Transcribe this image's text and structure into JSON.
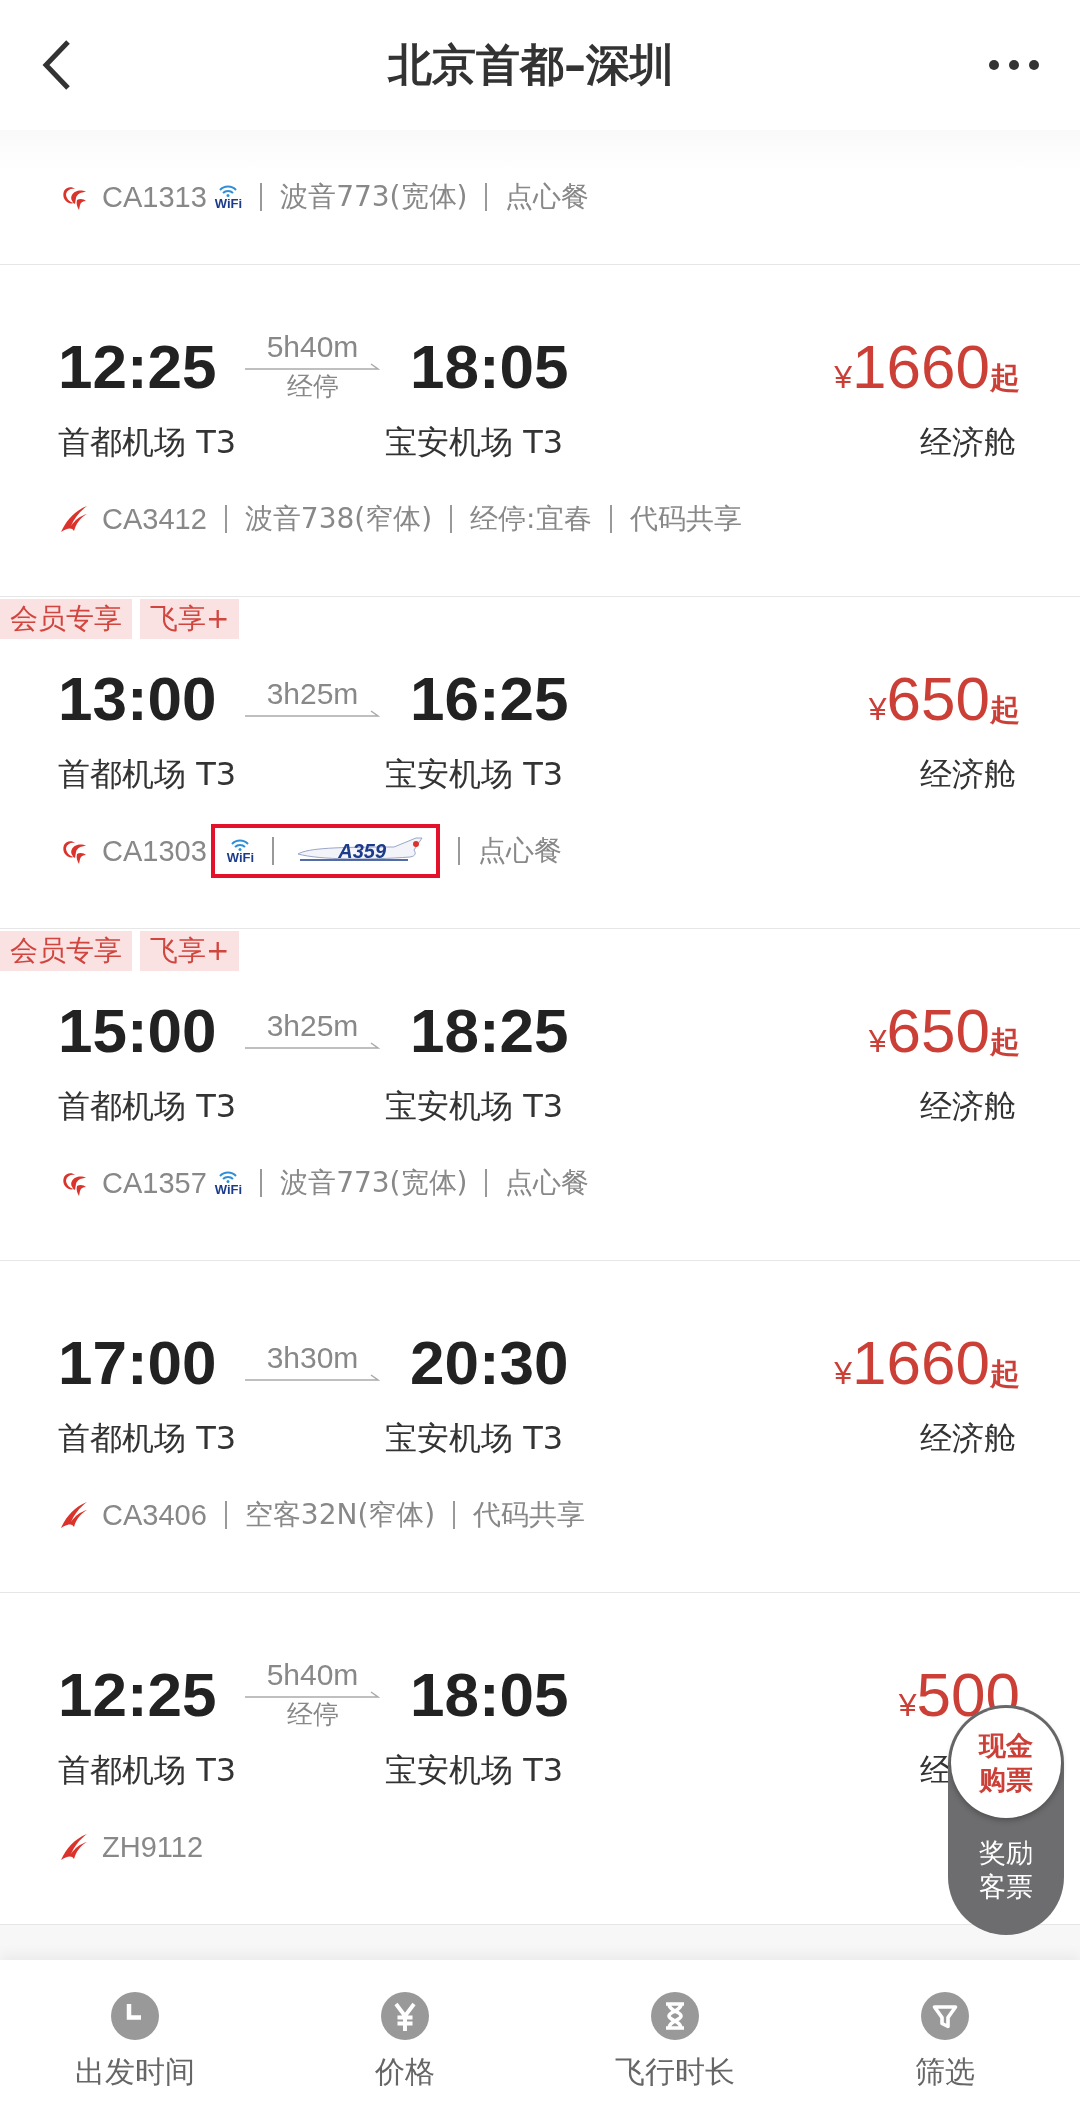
{
  "header": {
    "title": "北京首都–深圳"
  },
  "partial_flight": {
    "logo": {
      "kind": "phoenix"
    },
    "flight_no": "CA1313",
    "items": [
      {
        "kind": "wifi",
        "label": "WiFi"
      },
      {
        "kind": "text",
        "label": "波音773(宽体)"
      },
      {
        "kind": "text",
        "label": "点心餐"
      }
    ]
  },
  "flights": [
    {
      "dep_time": "12:25",
      "duration": "5h40m",
      "stop": "经停",
      "arr_time": "18:05",
      "dep_airport": "首都机场 T3",
      "arr_airport": "宝安机场 T3",
      "currency": "¥",
      "price": "1660",
      "suffix": "起",
      "cabin": "经济舱",
      "logo": {
        "kind": "swoosh"
      },
      "flight_no": "CA3412",
      "items": [
        {
          "kind": "text",
          "label": "波音738(窄体)"
        },
        {
          "kind": "text",
          "label": "经停:宜春"
        },
        {
          "kind": "text",
          "label": "代码共享"
        }
      ]
    },
    {
      "tags": [
        "会员专享",
        "飞享+"
      ],
      "dep_time": "13:00",
      "duration": "3h25m",
      "arr_time": "16:25",
      "dep_airport": "首都机场 T3",
      "arr_airport": "宝安机场 T3",
      "currency": "¥",
      "price": "650",
      "suffix": "起",
      "cabin": "经济舱",
      "logo": {
        "kind": "phoenix"
      },
      "flight_no": "CA1303",
      "framed": true,
      "items": [
        {
          "kind": "wifi",
          "label": "WiFi"
        },
        {
          "kind": "plane",
          "label": "A359"
        },
        {
          "kind": "text",
          "label": "点心餐"
        }
      ]
    },
    {
      "tags": [
        "会员专享",
        "飞享+"
      ],
      "dep_time": "15:00",
      "duration": "3h25m",
      "arr_time": "18:25",
      "dep_airport": "首都机场 T3",
      "arr_airport": "宝安机场 T3",
      "currency": "¥",
      "price": "650",
      "suffix": "起",
      "cabin": "经济舱",
      "logo": {
        "kind": "phoenix"
      },
      "flight_no": "CA1357",
      "framed": false,
      "items": [
        {
          "kind": "wifi",
          "label": "WiFi"
        },
        {
          "kind": "text",
          "label": "波音773(宽体)"
        },
        {
          "kind": "text",
          "label": "点心餐"
        }
      ]
    },
    {
      "dep_time": "17:00",
      "duration": "3h30m",
      "arr_time": "20:30",
      "dep_airport": "首都机场 T3",
      "arr_airport": "宝安机场 T3",
      "currency": "¥",
      "price": "1660",
      "suffix": "起",
      "cabin": "经济舱",
      "logo": {
        "kind": "swoosh"
      },
      "flight_no": "CA3406",
      "items": [
        {
          "kind": "text",
          "label": "空客32N(窄体)"
        },
        {
          "kind": "text",
          "label": "代码共享"
        }
      ]
    },
    {
      "dep_time": "12:25",
      "duration": "5h40m",
      "stop": "经停",
      "arr_time": "18:05",
      "dep_airport": "首都机场 T3",
      "arr_airport": "宝安机场 T3",
      "currency": "¥",
      "price": "500",
      "cabin": "经",
      "logo": {
        "kind": "swoosh"
      },
      "flight_no": "ZH9112"
    }
  ],
  "float_button": {
    "top": "现金购票",
    "bottom": "奖励客票"
  },
  "bottom_nav": [
    {
      "kind": "clock",
      "label": "出发时间"
    },
    {
      "kind": "price",
      "label": "价格"
    },
    {
      "kind": "hourglass",
      "label": "飞行时长"
    },
    {
      "kind": "filter",
      "label": "筛选"
    }
  ]
}
